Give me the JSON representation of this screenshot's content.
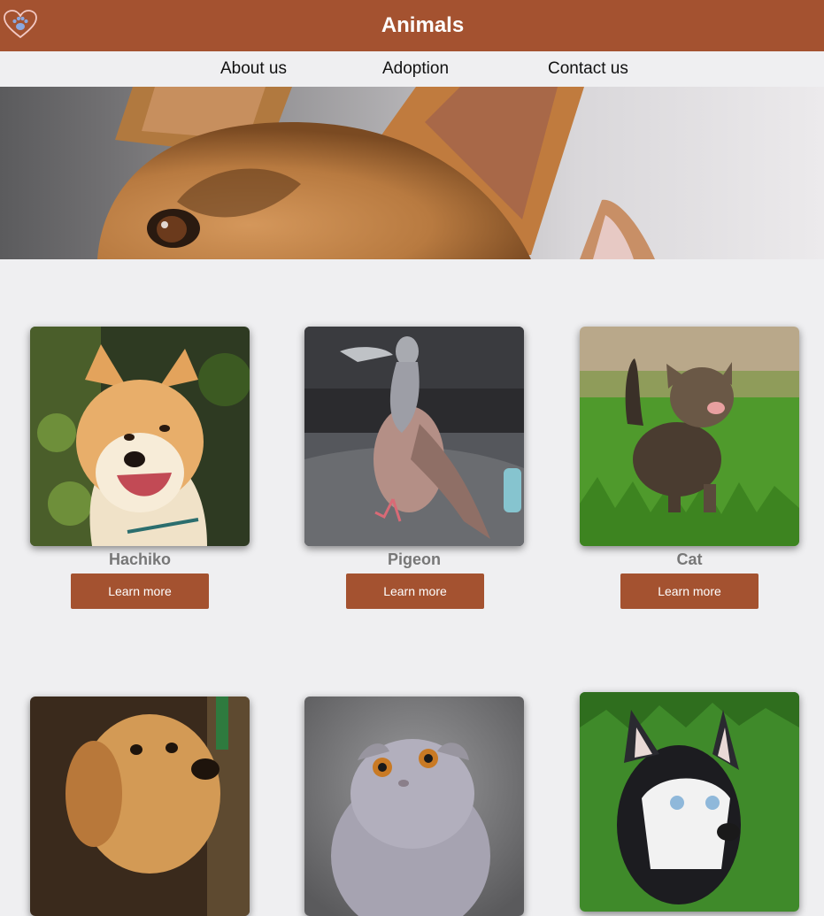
{
  "header": {
    "title": "Animals",
    "logo_icon": "heart-paw-icon",
    "background": "#a45230"
  },
  "nav": {
    "items": [
      {
        "label": "About us"
      },
      {
        "label": "Adoption"
      },
      {
        "label": "Contact us"
      }
    ]
  },
  "hero": {
    "image": "dog-and-cat-closeup-photo"
  },
  "cards": [
    {
      "name": "Hachiko",
      "image": "shiba-inu-photo",
      "button_label": "Learn more"
    },
    {
      "name": "Pigeon",
      "image": "pigeon-photo",
      "button_label": "Learn more"
    },
    {
      "name": "Cat",
      "image": "kitten-photo",
      "button_label": "Learn more"
    },
    {
      "name": "",
      "image": "golden-retriever-puppy-photo",
      "button_label": ""
    },
    {
      "name": "",
      "image": "scottish-fold-cat-photo",
      "button_label": ""
    },
    {
      "name": "",
      "image": "husky-puppy-photo",
      "button_label": ""
    }
  ],
  "colors": {
    "accent": "#a45230",
    "page_background": "#efeff1",
    "card_name": "#777777"
  }
}
